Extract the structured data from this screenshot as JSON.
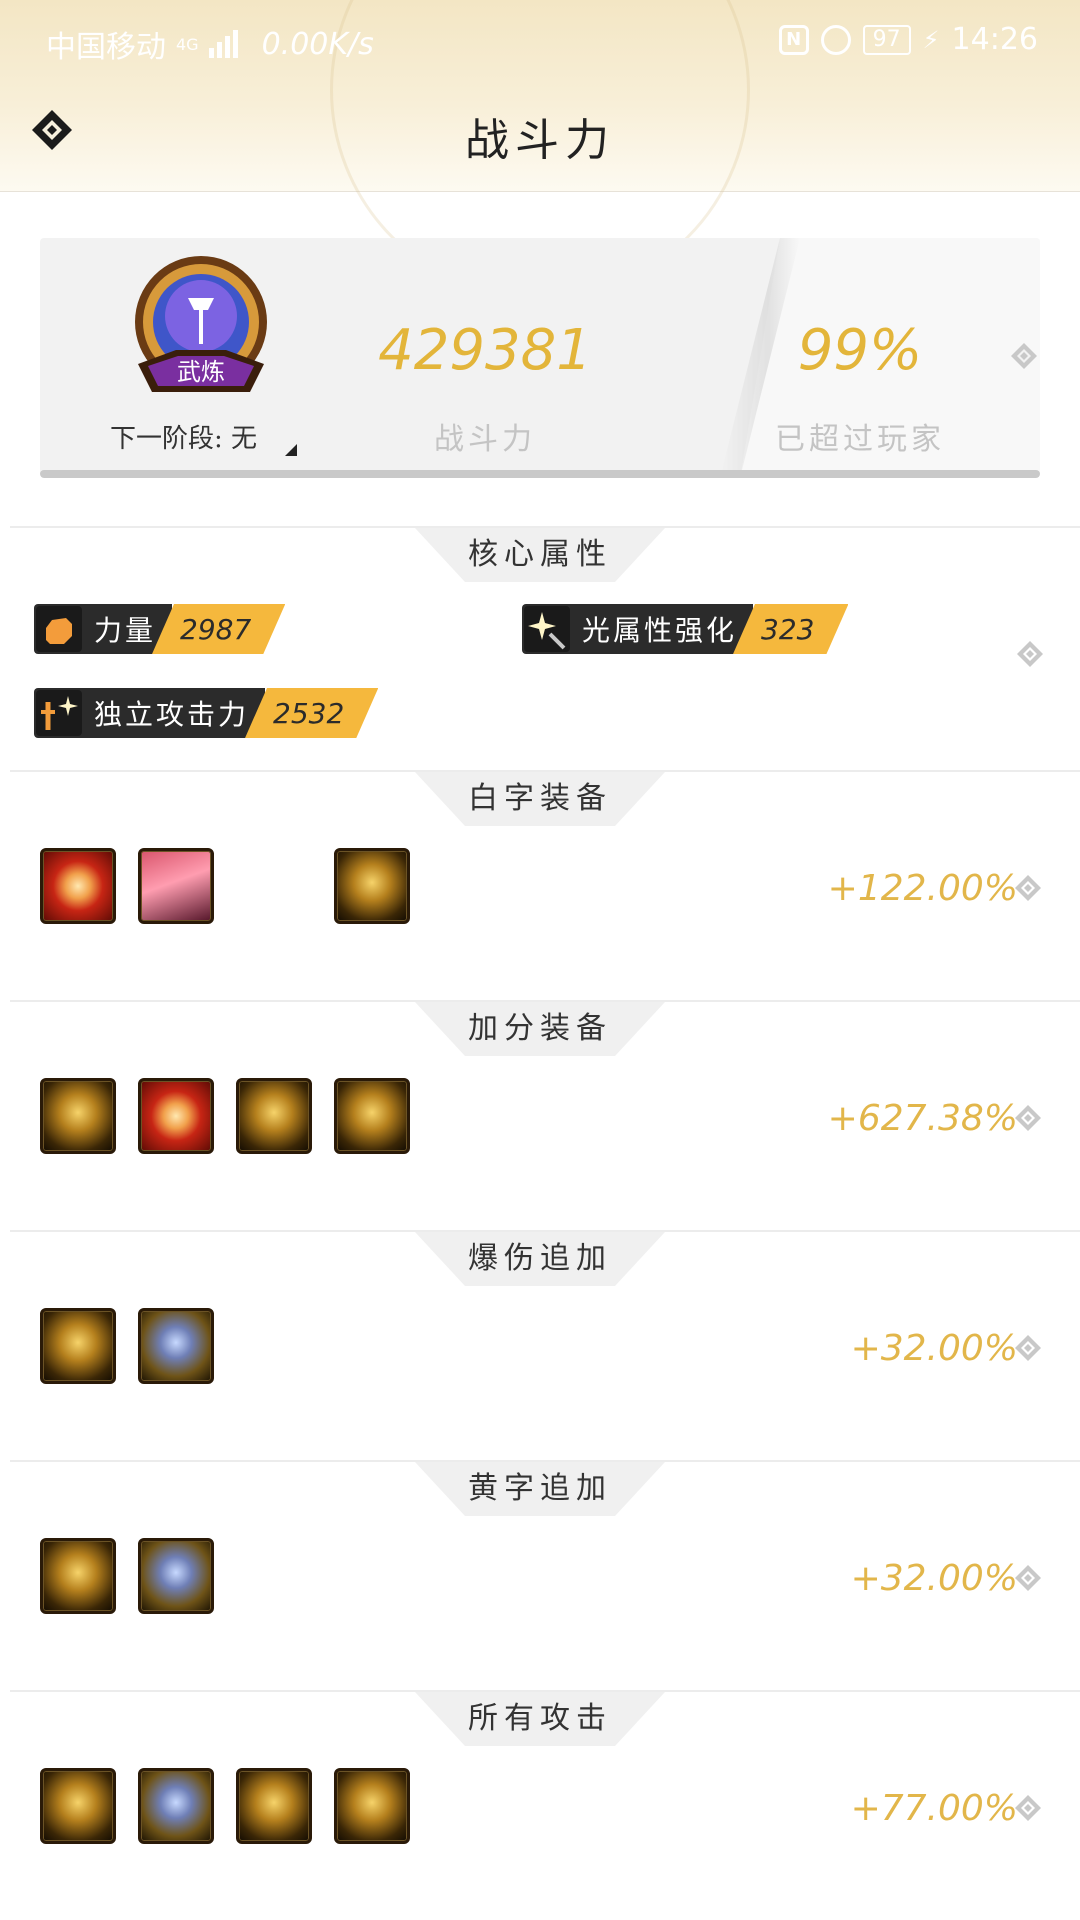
{
  "status_bar": {
    "carrier": "中国移动",
    "network_type": "4G",
    "speed": "0.00K/s",
    "battery": "97",
    "time": "14:26"
  },
  "header": {
    "title": "战斗力"
  },
  "summary": {
    "badge_text": "武炼",
    "next_stage": "下一阶段: 无",
    "power_value": "429381",
    "power_label": "战斗力",
    "percent_value": "99%",
    "percent_label": "已超过玩家"
  },
  "core_attributes": {
    "title": "核心属性",
    "items": [
      {
        "name": "力量",
        "value": "2987",
        "icon": "fist-icon"
      },
      {
        "name": "光属性强化",
        "value": "323",
        "icon": "light-burst-icon"
      },
      {
        "name": "独立攻击力",
        "value": "2532",
        "icon": "sword-sparkle-icon"
      }
    ]
  },
  "equipment_sections": [
    {
      "title": "白字装备",
      "bonus": "+122.00%"
    },
    {
      "title": "加分装备",
      "bonus": "+627.38%"
    },
    {
      "title": "爆伤追加",
      "bonus": "+32.00%"
    },
    {
      "title": "黄字追加",
      "bonus": "+32.00%"
    },
    {
      "title": "所有攻击",
      "bonus": "+77.00%"
    }
  ],
  "colors": {
    "accent_gold": "#e3b53a",
    "stat_tag": "#f5b83d",
    "stat_dark": "#2b2b2b"
  }
}
